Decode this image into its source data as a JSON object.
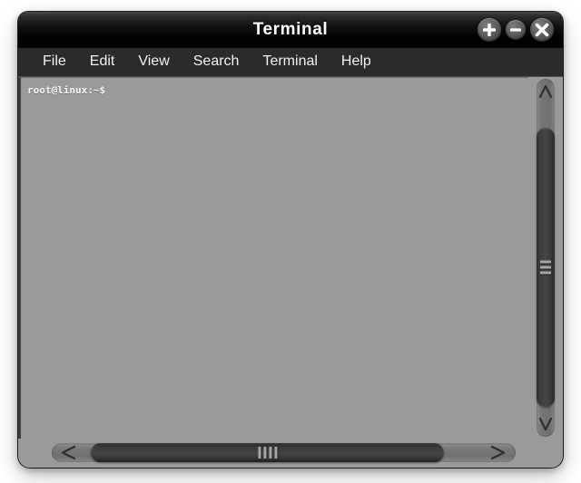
{
  "window": {
    "title": "Terminal",
    "controls": [
      {
        "name": "maximize-button",
        "icon": "plus-icon",
        "label": "Maximize"
      },
      {
        "name": "minimize-button",
        "icon": "minus-icon",
        "label": "Minimize"
      },
      {
        "name": "close-button",
        "icon": "close-icon",
        "label": "Close"
      }
    ]
  },
  "menubar": {
    "items": [
      {
        "label": "File"
      },
      {
        "label": "Edit"
      },
      {
        "label": "View"
      },
      {
        "label": "Search"
      },
      {
        "label": "Terminal"
      },
      {
        "label": "Help"
      }
    ]
  },
  "terminal": {
    "prompt": "root@linux:~$",
    "lines": [
      "root@linux:~$"
    ],
    "background_color": "#9a9a9a",
    "foreground_color": "#f4f4f4"
  },
  "scrollbars": {
    "vertical": {
      "up_arrow_icon": "chevron-up-icon",
      "down_arrow_icon": "chevron-down-icon",
      "grip_lines": 3
    },
    "horizontal": {
      "left_arrow_icon": "chevron-left-icon",
      "right_arrow_icon": "chevron-right-icon",
      "grip_lines": 4
    }
  },
  "colors": {
    "titlebar": "#000000",
    "menubar": "#2b2b2b",
    "window_frame": "#9a9a9a",
    "terminal_bg": "#9a9a9a",
    "text": "#ffffff"
  }
}
